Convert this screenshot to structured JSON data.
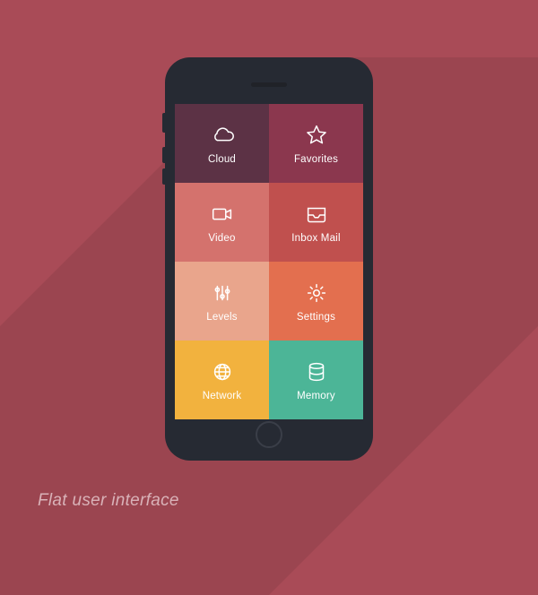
{
  "caption": "Flat user interface",
  "tiles": [
    {
      "name": "cloud",
      "label": "Cloud",
      "color": "#5c3245"
    },
    {
      "name": "favorites",
      "label": "Favorites",
      "color": "#8b374e"
    },
    {
      "name": "video",
      "label": "Video",
      "color": "#d4726d"
    },
    {
      "name": "inbox",
      "label": "Inbox Mail",
      "color": "#c0504e"
    },
    {
      "name": "levels",
      "label": "Levels",
      "color": "#e9a58c"
    },
    {
      "name": "settings",
      "label": "Settings",
      "color": "#e36f4f"
    },
    {
      "name": "network",
      "label": "Network",
      "color": "#f2b23e"
    },
    {
      "name": "memory",
      "label": "Memory",
      "color": "#4cb597"
    }
  ]
}
